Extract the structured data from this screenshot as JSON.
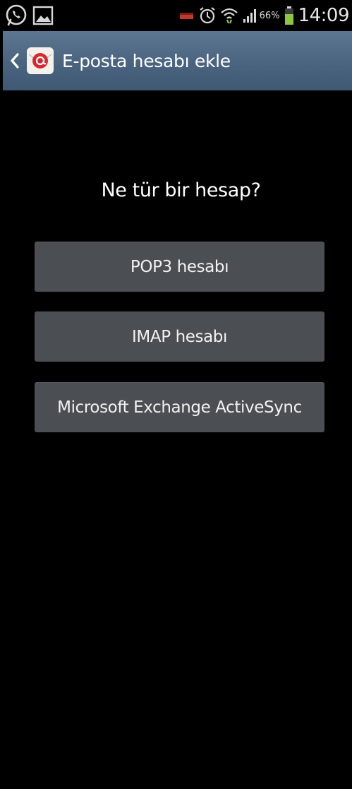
{
  "status_bar": {
    "battery_percent": "66%",
    "time": "14:09",
    "left_icons": [
      "whatsapp-icon",
      "gallery-icon"
    ],
    "right_icons": [
      "battery-low-icon",
      "alarm-icon",
      "wifi-icon",
      "signal-icon",
      "battery-icon"
    ],
    "battery_color": "#8dc63f",
    "battery_level": 0.66
  },
  "action_bar": {
    "back_icon": "chevron-left-icon",
    "app_icon": "email-icon",
    "title": "E-posta hesabı ekle",
    "background_color": "#4a6480"
  },
  "main": {
    "question": "Ne tür bir hesap?",
    "options": [
      {
        "label": "POP3 hesabı"
      },
      {
        "label": "IMAP hesabı"
      },
      {
        "label": "Microsoft Exchange ActiveSync"
      }
    ],
    "button_color": "#4b4e52"
  }
}
